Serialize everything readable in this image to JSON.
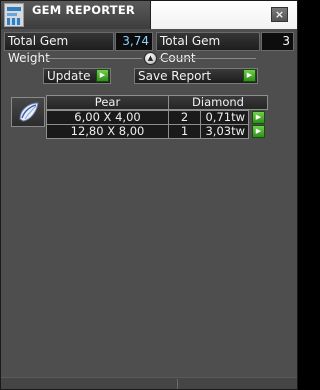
{
  "window": {
    "title": "GEM REPORTER",
    "close_label": "×"
  },
  "summary": {
    "weight_label": "Total Gem Weight",
    "weight_value": "3,74",
    "count_label": "Total Gem Count",
    "count_value": "3"
  },
  "actions": {
    "update_label": "Update",
    "save_label": "Save Report"
  },
  "table": {
    "headers": {
      "shape": "Pear",
      "type": "Diamond"
    },
    "rows": [
      {
        "size": "6,00 X 4,00",
        "qty": "2",
        "weight": "0,71tw"
      },
      {
        "size": "12,80 X 8,00",
        "qty": "1",
        "weight": "3,03tw"
      }
    ]
  },
  "icons": {
    "app": "gem-reporter-app-icon",
    "gem": "pear-gem-icon",
    "go": "green-play-arrow-icon",
    "collapse": "up-arrow-collapse-icon"
  },
  "colors": {
    "panel": "#4e4e4e",
    "value_text": "#8fd0ff",
    "go_button": "#3fa52a"
  }
}
